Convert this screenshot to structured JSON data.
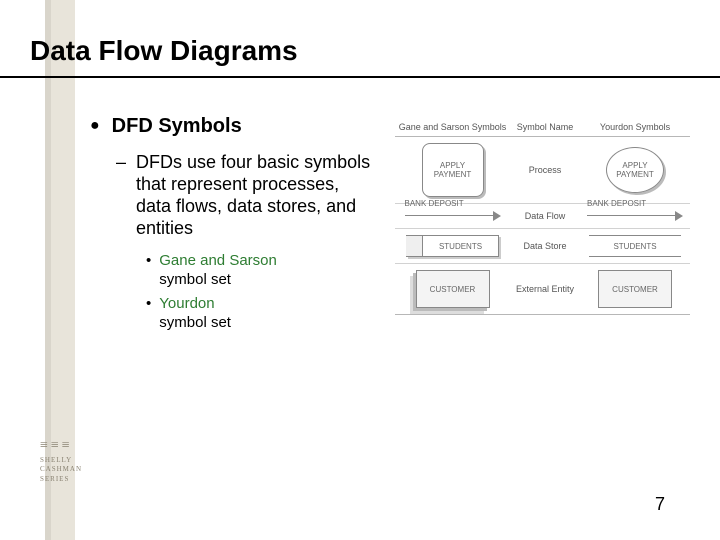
{
  "title": "Data Flow Diagrams",
  "page_number": "7",
  "brand": {
    "glyphs": "≡≡≡",
    "l1": "SHELLY",
    "l2": "CASHMAN",
    "l3": "SERIES"
  },
  "bullets": {
    "l1": "DFD Symbols",
    "l2": "DFDs use four basic symbols that represent processes, data flows, data stores, and entities",
    "l3a_green": "Gane and Sarson",
    "l3a_rest": " symbol set",
    "l3b_green": "Yourdon",
    "l3b_rest": " symbol set"
  },
  "figure": {
    "headers": {
      "c1": "Gane and Sarson Symbols",
      "c2": "Symbol Name",
      "c3": "Yourdon Symbols"
    },
    "rows": [
      {
        "name": "Process",
        "gs_label": "APPLY PAYMENT",
        "y_label": "APPLY PAYMENT"
      },
      {
        "name": "Data Flow",
        "gs_label": "BANK DEPOSIT",
        "y_label": "BANK DEPOSIT"
      },
      {
        "name": "Data Store",
        "gs_label": "STUDENTS",
        "y_label": "STUDENTS"
      },
      {
        "name": "External Entity",
        "gs_label": "CUSTOMER",
        "y_label": "CUSTOMER"
      }
    ]
  }
}
